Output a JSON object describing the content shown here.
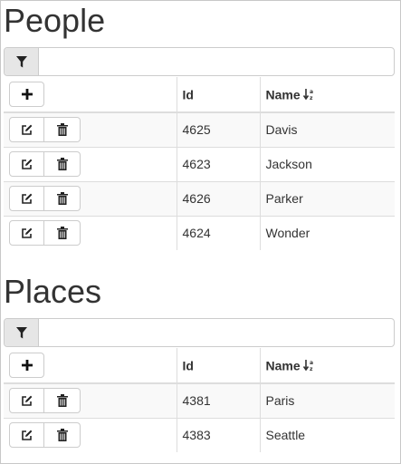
{
  "people": {
    "title": "People",
    "filter": {
      "value": "",
      "placeholder": ""
    },
    "columns": {
      "id": "Id",
      "name": "Name"
    },
    "rows": [
      {
        "id": "4625",
        "name": "Davis"
      },
      {
        "id": "4623",
        "name": "Jackson"
      },
      {
        "id": "4626",
        "name": "Parker"
      },
      {
        "id": "4624",
        "name": "Wonder"
      }
    ]
  },
  "places": {
    "title": "Places",
    "filter": {
      "value": "",
      "placeholder": ""
    },
    "columns": {
      "id": "Id",
      "name": "Name"
    },
    "rows": [
      {
        "id": "4381",
        "name": "Paris"
      },
      {
        "id": "4383",
        "name": "Seattle"
      }
    ]
  },
  "icons": {
    "filter": "filter-icon",
    "add": "plus-icon",
    "edit": "edit-icon",
    "delete": "trash-icon",
    "sort": "sort-alpha-icon"
  },
  "colors": {
    "text": "#333333",
    "border": "#dddddd",
    "stripe": "#f9f9f9",
    "button_border": "#cccccc",
    "filter_button_bg": "#e6e6e6"
  }
}
